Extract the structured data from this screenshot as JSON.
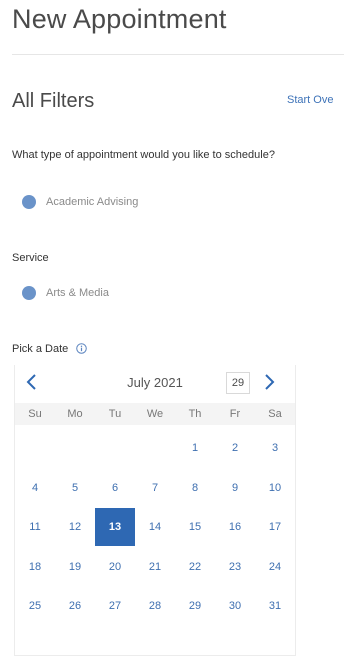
{
  "header": {
    "title": "New Appointment"
  },
  "filters": {
    "title": "All Filters",
    "start_over": "Start Ove"
  },
  "appointment_type": {
    "question": "What type of appointment would you like to schedule?",
    "selected": "Academic Advising"
  },
  "service": {
    "label": "Service",
    "selected": "Arts & Media"
  },
  "date_picker": {
    "label": "Pick a Date",
    "month_label": "July 2021",
    "today_button": "29",
    "weekdays": [
      "Su",
      "Mo",
      "Tu",
      "We",
      "Th",
      "Fr",
      "Sa"
    ],
    "weeks": [
      [
        "",
        "",
        "",
        "",
        "1",
        "2",
        "3"
      ],
      [
        "4",
        "5",
        "6",
        "7",
        "8",
        "9",
        "10"
      ],
      [
        "11",
        "12",
        "13",
        "14",
        "15",
        "16",
        "17"
      ],
      [
        "18",
        "19",
        "20",
        "21",
        "22",
        "23",
        "24"
      ],
      [
        "25",
        "26",
        "27",
        "28",
        "29",
        "30",
        "31"
      ]
    ],
    "selected_day": "13"
  },
  "colors": {
    "accent": "#2e68b3",
    "radio": "#6a93c9",
    "link": "#3e73b8"
  },
  "icons": {
    "info": "info-icon",
    "prev": "chevron-left-icon",
    "next": "chevron-right-icon"
  }
}
